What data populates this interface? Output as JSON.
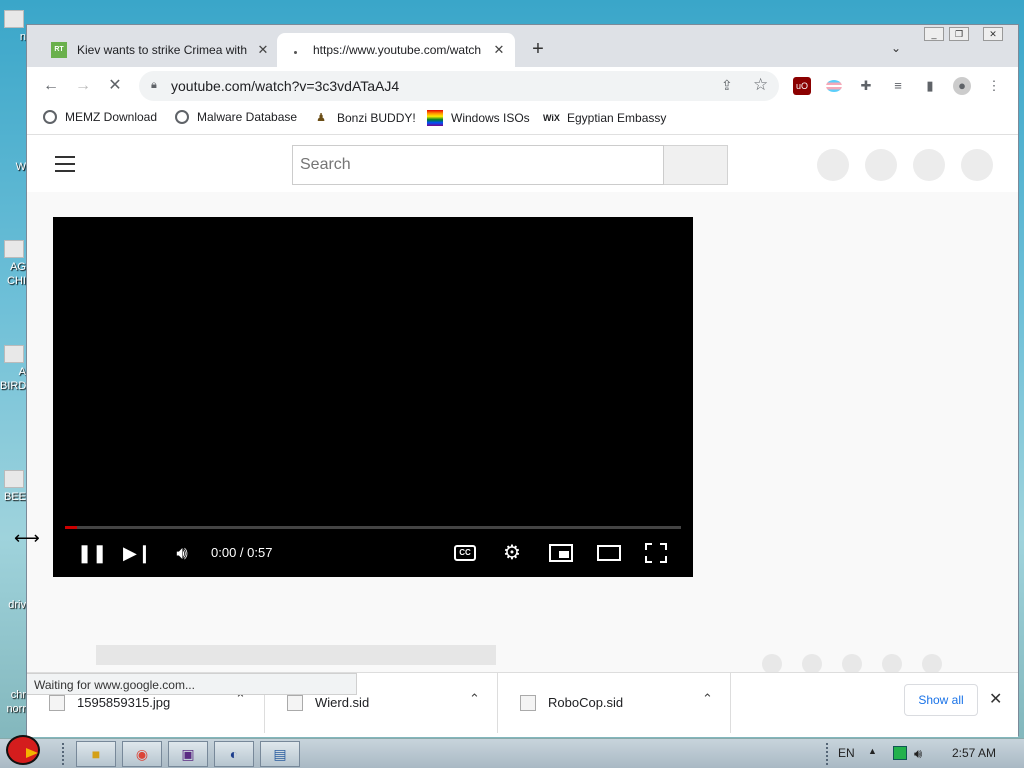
{
  "desktop": {
    "icon_labels": [
      "n",
      "W",
      "AG\nCHI",
      "A\nBIRD",
      "BEE",
      "driv",
      "chr\nnorr"
    ]
  },
  "browser": {
    "tabs": [
      {
        "title": "Kiev wants to strike Crimea with",
        "favicon": "RT"
      },
      {
        "title": "https://www.youtube.com/watch"
      }
    ],
    "address": {
      "url": "youtube.com/watch?v=3c3vdATaAJ4"
    },
    "bookmarks": [
      {
        "label": "MEMZ Download",
        "icon": "globe-icon"
      },
      {
        "label": "Malware Database",
        "icon": "globe-icon"
      },
      {
        "label": "Bonzi BUDDY!",
        "icon": "bonzi-icon"
      },
      {
        "label": "Windows ISOs",
        "icon": "rainbow-flag-icon"
      },
      {
        "label": "Egyptian Embassy",
        "icon": "wix-icon",
        "icon_text": "WiX"
      }
    ]
  },
  "youtube": {
    "search_placeholder": "Search",
    "player": {
      "time": "0:00 / 0:57",
      "progress": 0.02,
      "cc_label": "CC"
    }
  },
  "status": {
    "text": "Waiting for www.google.com..."
  },
  "downloads": {
    "items": [
      {
        "name": "1595859315.jpg"
      },
      {
        "name": "Wierd.sid"
      },
      {
        "name": "RoboCop.sid"
      }
    ],
    "show_all": "Show all"
  },
  "taskbar": {
    "language": "EN",
    "clock": "2:57 AM"
  },
  "colors": {
    "accent": "#1a73e8",
    "progress": "#cc0000"
  }
}
